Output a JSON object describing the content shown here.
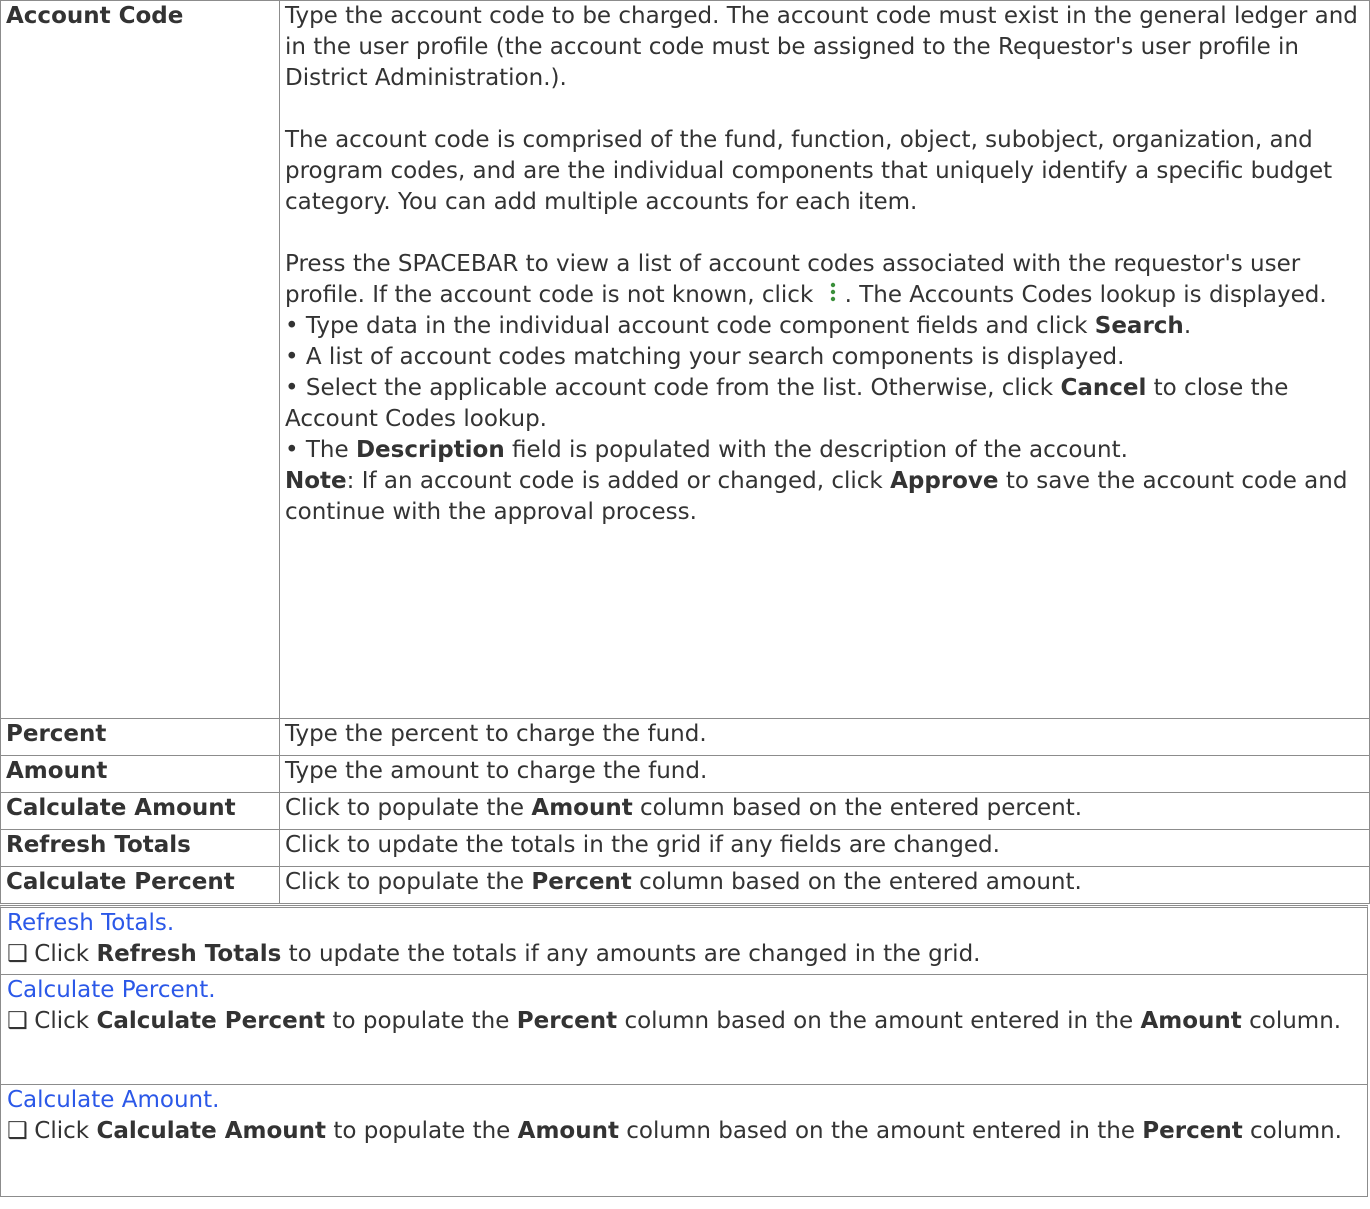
{
  "rows": [
    {
      "term": "Account Code",
      "p1": "Type the account code to be charged. The account code must exist in the general ledger and in the user profile (the account code must be assigned to the Requestor's user profile in District Administration.).",
      "p2": "The account code is comprised of the fund, function, object, subobject, organization, and program codes, and are the individual components that uniquely identify a specific budget category. You can add multiple accounts for each item.",
      "p3_a": "Press the SPACEBAR to view a list of account codes associated with the requestor's user profile. If the account code is not known, click ",
      "p3_b": ". The Accounts Codes lookup is displayed.",
      "b1_a": "• Type data in the individual account code component fields and click ",
      "b1_bold": "Search",
      "b1_b": ".",
      "b2": "• A list of account codes matching your search components is displayed.",
      "b3_a": "• Select the applicable account code from the list. Otherwise, click ",
      "b3_bold": "Cancel",
      "b3_b": " to close the Account Codes lookup.",
      "b4_a": "• The ",
      "b4_bold": "Description",
      "b4_b": " field is populated with the description of the account.",
      "note_bold": "Note",
      "note_a": ": If an account code is added or changed, click ",
      "note_bold2": "Approve",
      "note_b": " to save the account code and continue with the approval process."
    },
    {
      "term": "Percent",
      "desc": "Type the percent to charge the fund."
    },
    {
      "term": "Amount",
      "desc": "Type the amount to charge the fund."
    },
    {
      "term": "Calculate Amount",
      "desc_a": "Click to populate the ",
      "desc_bold": "Amount",
      "desc_b": " column based on the entered percent."
    },
    {
      "term": "Refresh Totals",
      "desc": "Click to update the totals in the grid if any fields are changed."
    },
    {
      "term": "Calculate Percent",
      "desc_a": "Click to populate the ",
      "desc_bold": "Percent",
      "desc_b": " column based on the entered amount."
    }
  ],
  "sections": [
    {
      "link": "Refresh Totals.",
      "checkbox": "❑",
      "step_a": " Click ",
      "step_bold": "Refresh Totals",
      "step_b": " to update the totals if any amounts are changed in the grid."
    },
    {
      "link": "Calculate Percent.",
      "checkbox": "❑",
      "step_a": " Click ",
      "step_bold": "Calculate Percent",
      "step_b": " to populate the ",
      "step_bold2": "Percent",
      "step_c": " column based on the amount entered in the ",
      "step_bold3": "Amount",
      "step_d": " column."
    },
    {
      "link": "Calculate Amount.",
      "checkbox": "❑",
      "step_a": " Click ",
      "step_bold": "Calculate Amount",
      "step_b": " to populate the ",
      "step_bold2": "Amount",
      "step_c": " column based on the amount entered in the ",
      "step_bold3": "Percent",
      "step_d": " column."
    }
  ],
  "icons": {
    "kebab": "more-vertical-icon",
    "checkbox": "checkbox-icon"
  },
  "colors": {
    "link": "#2b58e8",
    "text": "#333333",
    "border": "#8c8c8c",
    "kebab": "#3a8f3a"
  }
}
